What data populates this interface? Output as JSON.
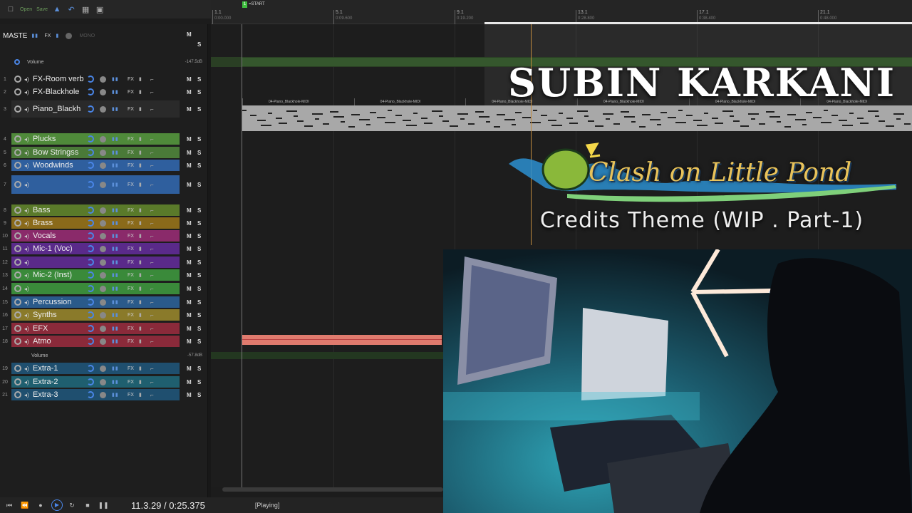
{
  "toolbar": {
    "open_label": "Open",
    "save_label": "Save"
  },
  "ruler": {
    "start_label": "=START",
    "marks": [
      {
        "bar": "1.1",
        "time": "0:00.000"
      },
      {
        "bar": "5.1",
        "time": "0:09.600"
      },
      {
        "bar": "9.1",
        "time": "0:19.200"
      },
      {
        "bar": "13.1",
        "time": "0:28.800"
      },
      {
        "bar": "17.1",
        "time": "0:38.400"
      },
      {
        "bar": "21.1",
        "time": "0:48.000"
      }
    ]
  },
  "master": {
    "name": "MASTE",
    "fx": "FX",
    "mono": "MONO",
    "m": "M",
    "s": "S",
    "volume_label": "Volume",
    "volume_db": "-147.5dB"
  },
  "tracks": [
    {
      "num": "1",
      "name": "FX-Room verb",
      "color": "#1e1e1e"
    },
    {
      "num": "2",
      "name": "FX-Blackhole",
      "color": "#1e1e1e"
    },
    {
      "num": "3",
      "name": "Piano_Blackh",
      "color": "#2a2a2a"
    },
    {
      "num": "4",
      "name": "Plucks",
      "color": "#4f8a3a"
    },
    {
      "num": "5",
      "name": "Bow Stringss",
      "color": "#4a7a38"
    },
    {
      "num": "6",
      "name": "Woodwinds",
      "color": "#2f5f9e"
    },
    {
      "num": "7",
      "name": "",
      "color": "#2f5f9e"
    },
    {
      "num": "8",
      "name": "Bass",
      "color": "#5a7a2a"
    },
    {
      "num": "9",
      "name": "Brass",
      "color": "#8a6a1a"
    },
    {
      "num": "10",
      "name": "Vocals",
      "color": "#8a2a6a"
    },
    {
      "num": "11",
      "name": "Mic-1 (Voc)",
      "color": "#5a2a8a"
    },
    {
      "num": "12",
      "name": "",
      "color": "#5a2a8a"
    },
    {
      "num": "13",
      "name": "Mic-2 (Inst)",
      "color": "#3a8a3a"
    },
    {
      "num": "14",
      "name": "",
      "color": "#3a8a3a"
    },
    {
      "num": "15",
      "name": "Percussion",
      "color": "#2a5a8a"
    },
    {
      "num": "16",
      "name": "Synths",
      "color": "#8a7a2a"
    },
    {
      "num": "17",
      "name": "EFX",
      "color": "#8a2a3a"
    },
    {
      "num": "18",
      "name": "Atmo",
      "color": "#8a2a3a"
    },
    {
      "num": "19",
      "name": "Extra-1",
      "color": "#1f4f6f"
    },
    {
      "num": "20",
      "name": "Extra-2",
      "color": "#1f5f6f"
    },
    {
      "num": "21",
      "name": "Extra-3",
      "color": "#1f4f6f"
    }
  ],
  "track_labels": {
    "fx": "FX",
    "m": "M",
    "s": "S",
    "volume_label": "Volume",
    "atmo_volume_db": "-57.8dB"
  },
  "midi_clips": [
    "04-Piano_Blackhole-MIDI",
    "04-Piano_Blackhole-MIDI",
    "04-Piano_Blackhole-MIDI",
    "04-Piano_Blackhole-MIDI",
    "04-Piano_Blackhole-MIDI",
    "04-Piano_Blackhole-MIDI"
  ],
  "overlay": {
    "name": "SUBIN KARKANI",
    "logo_text": "Clash on Little Pond",
    "subtitle": "Credits Theme (WIP . Part-1)"
  },
  "transport": {
    "time": "11.3.29 / 0:25.375",
    "status": "[Playing]"
  },
  "colors": {
    "accent": "#4a86e8",
    "loop_marker": "#c28b3e",
    "midi_clip": "#a8a8a8",
    "atmo_clip": "#e07b6e"
  }
}
